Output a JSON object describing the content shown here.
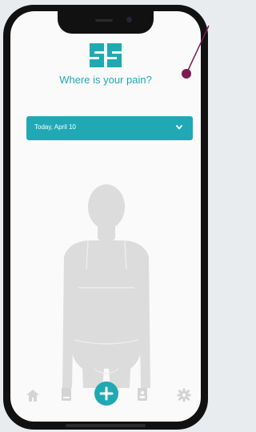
{
  "screen": {
    "title": "Where is your pain?",
    "date_select": {
      "value": "Today, April 10"
    }
  },
  "icons": {
    "logo": "brand-logo-icon",
    "chevron": "chevron-down-icon",
    "home": "home-icon",
    "journal": "book-icon",
    "add": "plus-icon",
    "profile": "profile-card-icon",
    "settings": "gear-icon"
  },
  "colors": {
    "accent": "#1fa9b3",
    "annotation": "#7b1c52",
    "figure": "#dcdcdc",
    "tab_icon": "#d4d4d4"
  }
}
